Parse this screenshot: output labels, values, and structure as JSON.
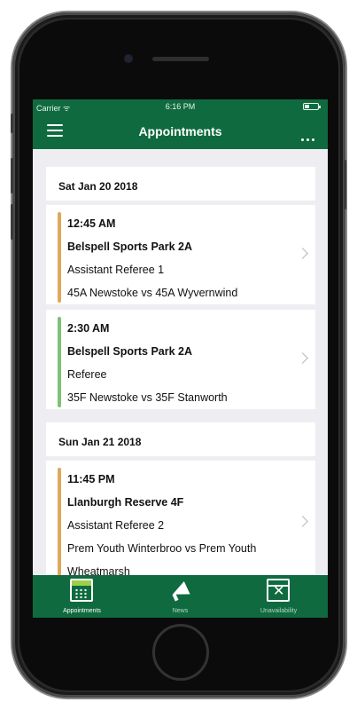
{
  "status_bar": {
    "carrier": "Carrier ᯤ",
    "time": "6:16 PM"
  },
  "nav": {
    "title": "Appointments"
  },
  "days": [
    {
      "date": "Sat Jan 20 2018",
      "appointments": [
        {
          "time": "12:45 AM",
          "venue": "Belspell Sports Park 2A",
          "role": "Assistant Referee 1",
          "match": "45A Newstoke vs 45A Wyvernwind",
          "match_cont": "",
          "accent": "#e0a85a"
        },
        {
          "time": "2:30 AM",
          "venue": "Belspell Sports Park 2A",
          "role": "Referee",
          "match": "35F Newstoke vs 35F Stanworth",
          "match_cont": "",
          "accent": "#7cc275"
        }
      ]
    },
    {
      "date": "Sun Jan 21 2018",
      "appointments": [
        {
          "time": "11:45 PM",
          "venue": "Llanburgh Reserve 4F",
          "role": "Assistant Referee 2",
          "match": "Prem Youth Winterbroo vs Prem Youth",
          "match_cont": "Wheatmarsh",
          "accent": "#e0a85a"
        }
      ]
    }
  ],
  "tabs": [
    {
      "label": "Appointments",
      "icon": "calendar-icon",
      "active": true
    },
    {
      "label": "News",
      "icon": "megaphone-icon",
      "active": false
    },
    {
      "label": "Unavailability",
      "icon": "unavailable-x-icon",
      "active": false
    }
  ],
  "colors": {
    "brand_green": "#0f6b3f",
    "accent_orange": "#e0a85a",
    "accent_green": "#7cc275"
  }
}
